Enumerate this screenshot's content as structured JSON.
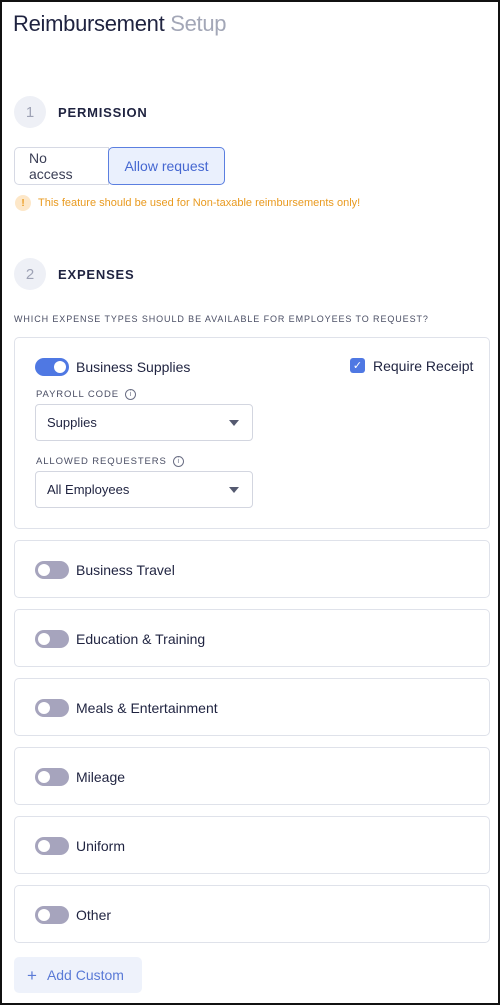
{
  "header": {
    "title_main": "Reimbursement",
    "title_sub": "Setup"
  },
  "permission": {
    "step": "1",
    "title": "PERMISSION",
    "options": [
      "No access",
      "Allow request"
    ],
    "selected": "Allow request",
    "warning": "This feature should be used for Non-taxable reimbursements only!"
  },
  "expenses": {
    "step": "2",
    "title": "EXPENSES",
    "question": "WHICH EXPENSE TYPES SHOULD BE AVAILABLE FOR EMPLOYEES TO REQUEST?",
    "expanded": {
      "label": "Business Supplies",
      "enabled": true,
      "require_receipt_label": "Require Receipt",
      "require_receipt": true,
      "payroll_code_label": "PAYROLL CODE",
      "payroll_code_value": "Supplies",
      "allowed_requesters_label": "ALLOWED REQUESTERS",
      "allowed_requesters_value": "All Employees"
    },
    "items": [
      {
        "label": "Business Travel",
        "enabled": false
      },
      {
        "label": "Education & Training",
        "enabled": false
      },
      {
        "label": "Meals & Entertainment",
        "enabled": false
      },
      {
        "label": "Mileage",
        "enabled": false
      },
      {
        "label": "Uniform",
        "enabled": false
      },
      {
        "label": "Other",
        "enabled": false
      }
    ]
  },
  "add_custom": {
    "icon": "plus-icon",
    "label": "Add Custom"
  },
  "colors": {
    "accent": "#4f78e3",
    "warning": "#e99a1f",
    "toggle_off": "#a6a4bd",
    "muted_text": "#a3a7b7"
  }
}
